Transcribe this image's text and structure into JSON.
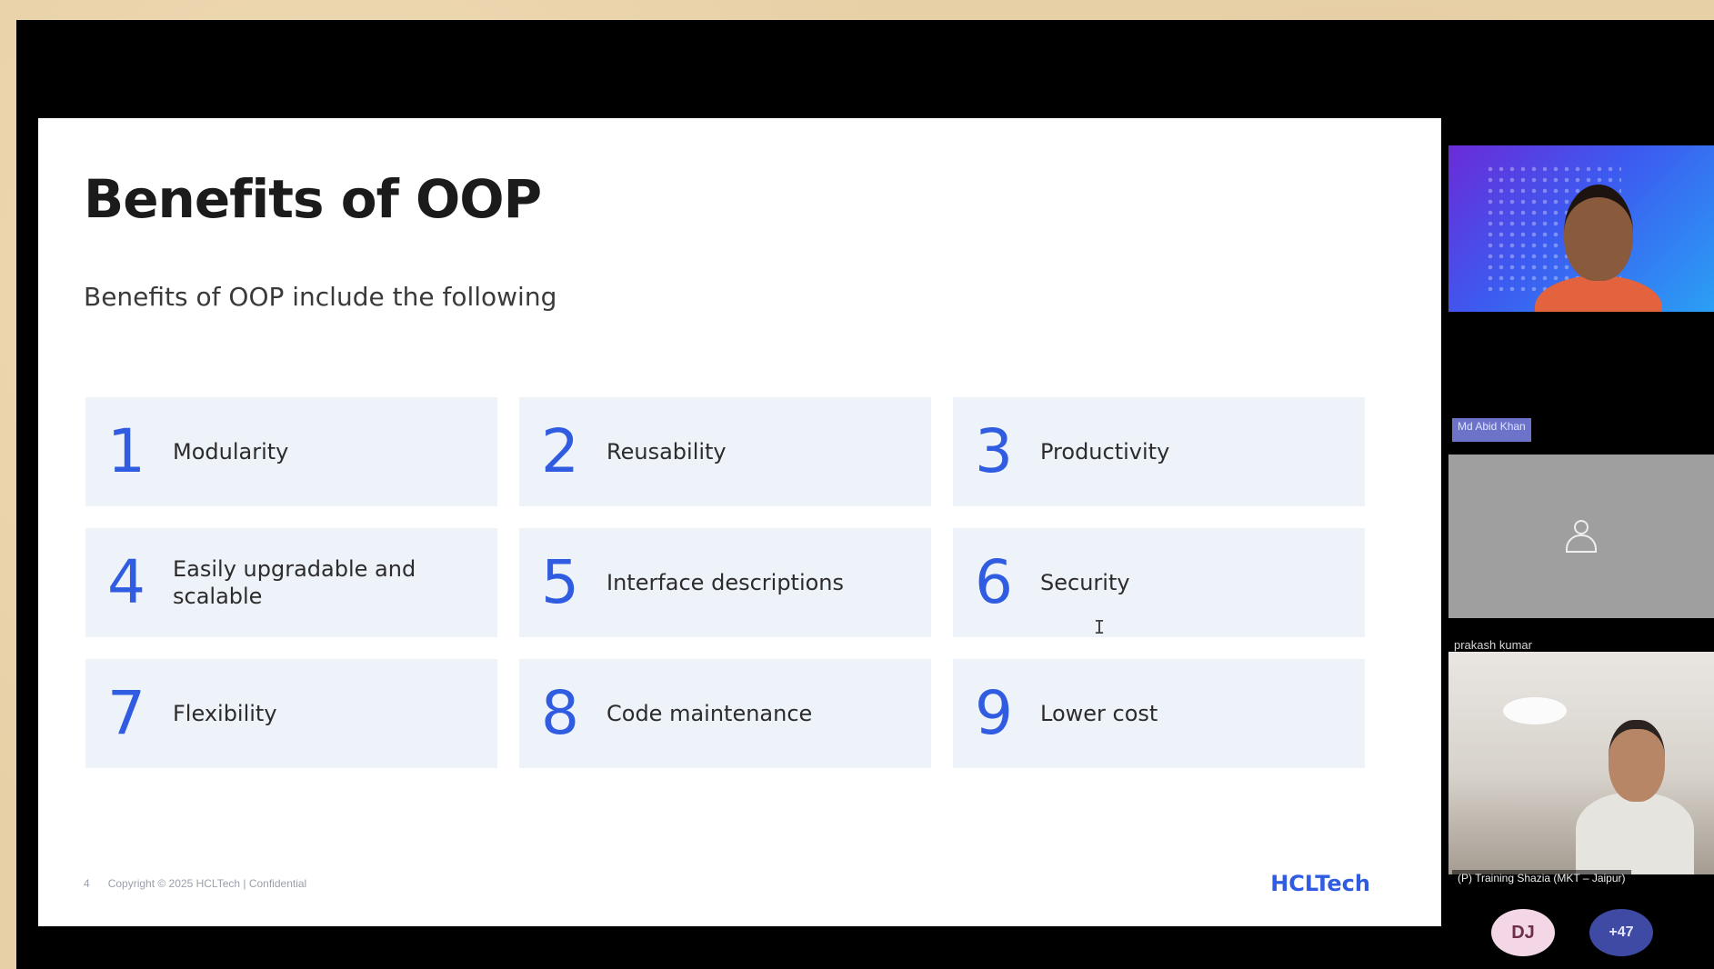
{
  "slide": {
    "title": "Benefits of OOP",
    "subtitle": "Benefits of OOP include the following",
    "items": [
      {
        "num": "1",
        "label": "Modularity"
      },
      {
        "num": "2",
        "label": "Reusability"
      },
      {
        "num": "3",
        "label": "Productivity"
      },
      {
        "num": "4",
        "label": "Easily upgradable and scalable"
      },
      {
        "num": "5",
        "label": "Interface descriptions"
      },
      {
        "num": "6",
        "label": "Security"
      },
      {
        "num": "7",
        "label": "Flexibility"
      },
      {
        "num": "8",
        "label": "Code maintenance"
      },
      {
        "num": "9",
        "label": "Lower cost"
      }
    ],
    "footer": {
      "page": "4",
      "copyright": "Copyright © 2025 HCLTech | Confidential",
      "brand": "HCLTech"
    }
  },
  "participants": {
    "tile1_name": "Md Abid Khan",
    "tile2_name": "prakash kumar",
    "tile3_name": "(P) Training Shazia (MKT – Jaipur)",
    "avatar_initials": "DJ",
    "more_count": "+47"
  },
  "colors": {
    "accent_blue": "#2f5ce0",
    "card_bg": "#eef2f9"
  }
}
